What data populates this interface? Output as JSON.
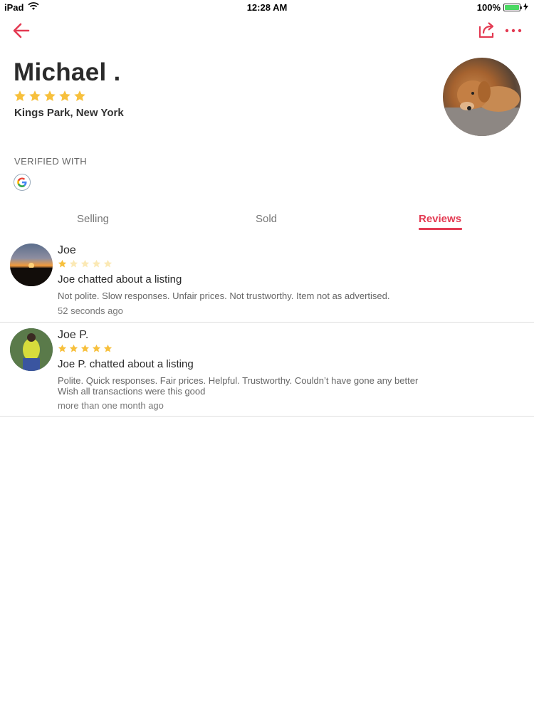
{
  "status_bar": {
    "device": "iPad",
    "time": "12:28 AM",
    "battery": "100%"
  },
  "profile": {
    "name": "Michael .",
    "rating": 5,
    "location": "Kings Park, New York",
    "verified_label": "VERIFIED WITH",
    "verified_provider_icon": "google-icon"
  },
  "tabs": {
    "selling": "Selling",
    "sold": "Sold",
    "reviews": "Reviews",
    "active": "reviews"
  },
  "reviews": [
    {
      "name": "Joe",
      "rating": 1,
      "title": "Joe chatted about a listing",
      "text": "Not polite. Slow responses. Unfair prices. Not trustworthy. Item not as advertised.",
      "time": "52 seconds ago"
    },
    {
      "name": "Joe P.",
      "rating": 5,
      "title": "Joe P. chatted about a listing",
      "text_line1": "Polite. Quick responses. Fair prices. Helpful. Trustworthy. Couldn’t have gone any better",
      "text_line2": "Wish all transactions were this good",
      "time": "more than one month ago"
    }
  ],
  "colors": {
    "accent": "#e33a52",
    "star_filled": "#f7c03c",
    "star_empty": "#fbe9b5"
  }
}
